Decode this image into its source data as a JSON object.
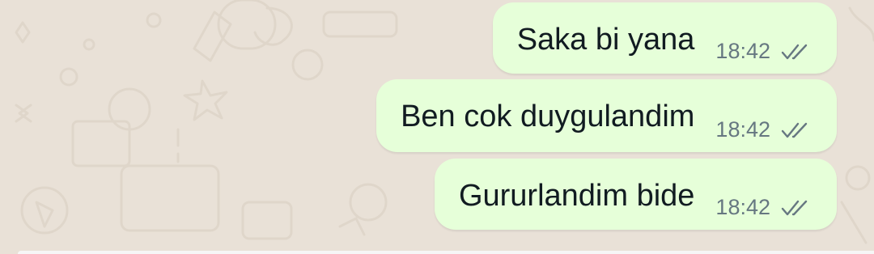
{
  "chat": {
    "messages": [
      {
        "text": "Saka bi yana",
        "time": "18:42",
        "status_icon": "double-check-icon"
      },
      {
        "text": "Ben cok duygulandim",
        "time": "18:42",
        "status_icon": "double-check-icon"
      },
      {
        "text": "Gururlandim bide",
        "time": "18:42",
        "status_icon": "double-check-icon"
      }
    ]
  },
  "colors": {
    "background": "#e9e1d7",
    "bubble_outgoing": "#e6ffd9",
    "text_primary": "#111b21",
    "text_meta": "#667781"
  }
}
